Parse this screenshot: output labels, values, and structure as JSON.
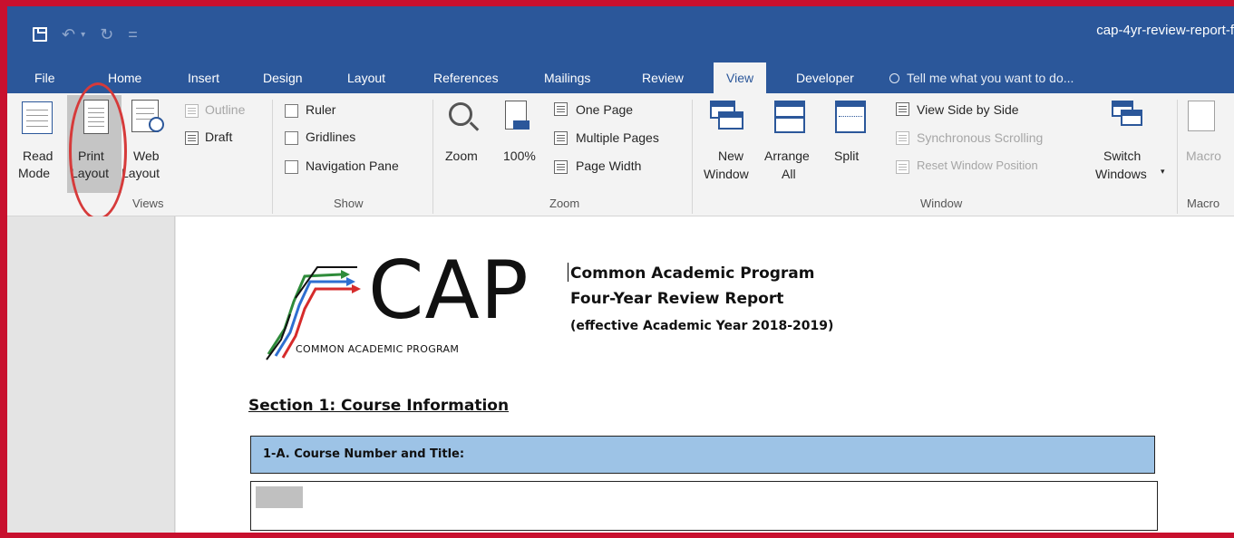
{
  "window": {
    "title": "cap-4yr-review-report-f"
  },
  "qat": {
    "save": "save-icon",
    "undo": "↶",
    "redo": "↻",
    "customize": "="
  },
  "tabs": [
    {
      "label": "File"
    },
    {
      "label": "Home"
    },
    {
      "label": "Insert"
    },
    {
      "label": "Design"
    },
    {
      "label": "Layout"
    },
    {
      "label": "References"
    },
    {
      "label": "Mailings"
    },
    {
      "label": "Review"
    },
    {
      "label": "View",
      "active": true
    },
    {
      "label": "Developer"
    }
  ],
  "tell_me": "Tell me what you want to do...",
  "ribbon": {
    "views": {
      "label": "Views",
      "read_mode": [
        "Read",
        "Mode"
      ],
      "print_layout": [
        "Print",
        "Layout"
      ],
      "web_layout": [
        "Web",
        "Layout"
      ],
      "outline": "Outline",
      "draft": "Draft"
    },
    "show": {
      "label": "Show",
      "ruler": "Ruler",
      "gridlines": "Gridlines",
      "navigation_pane": "Navigation Pane"
    },
    "zoom": {
      "label": "Zoom",
      "zoom": "Zoom",
      "hundred": "100%",
      "one_page": "One Page",
      "multiple_pages": "Multiple Pages",
      "page_width": "Page Width"
    },
    "window": {
      "label": "Window",
      "new_window": [
        "New",
        "Window"
      ],
      "arrange_all": [
        "Arrange",
        "All"
      ],
      "split": "Split",
      "side_by_side": "View Side by Side",
      "sync_scroll": "Synchronous Scrolling",
      "reset_pos": "Reset Window Position",
      "switch": [
        "Switch",
        "Windows"
      ]
    },
    "macros": {
      "label": "Macro",
      "macros": "Macro"
    }
  },
  "document": {
    "logo_word": "CAP",
    "logo_sub": "COMMON ACADEMIC PROGRAM",
    "heading1": "Common Academic Program",
    "heading2": "Four-Year Review Report",
    "heading3": "(effective Academic Year 2018-2019)",
    "section": "Section 1: Course Information",
    "field_label": "1-A. Course Number and Title:"
  },
  "colors": {
    "ribbon_blue": "#2b579a",
    "field_header": "#9dc3e6",
    "annotation_red": "#d63a3a",
    "frame_red": "#c8102e"
  }
}
